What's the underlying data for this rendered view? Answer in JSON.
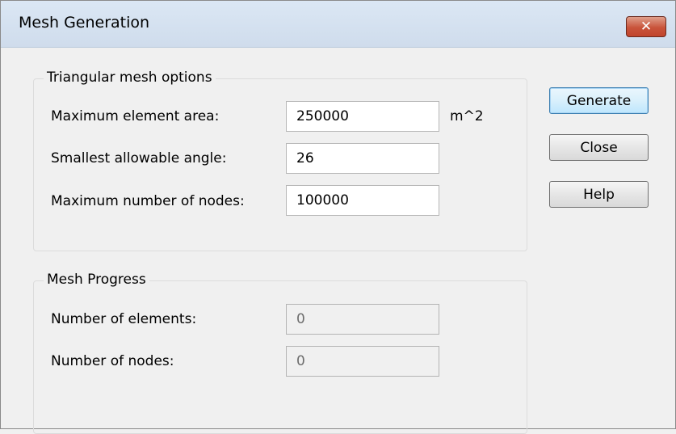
{
  "window": {
    "title": "Mesh Generation",
    "close_glyph": "✕"
  },
  "triangular": {
    "legend": "Triangular mesh options",
    "max_area_label": "Maximum element area:",
    "max_area_value": "250000",
    "max_area_unit": "m^2",
    "min_angle_label": "Smallest allowable angle:",
    "min_angle_value": "26",
    "max_nodes_label": "Maximum number of nodes:",
    "max_nodes_value": "100000"
  },
  "progress": {
    "legend": "Mesh Progress",
    "elements_label": "Number of elements:",
    "elements_value": "0",
    "nodes_label": "Number of nodes:",
    "nodes_value": "0"
  },
  "buttons": {
    "generate": "Generate",
    "close": "Close",
    "help": "Help"
  }
}
